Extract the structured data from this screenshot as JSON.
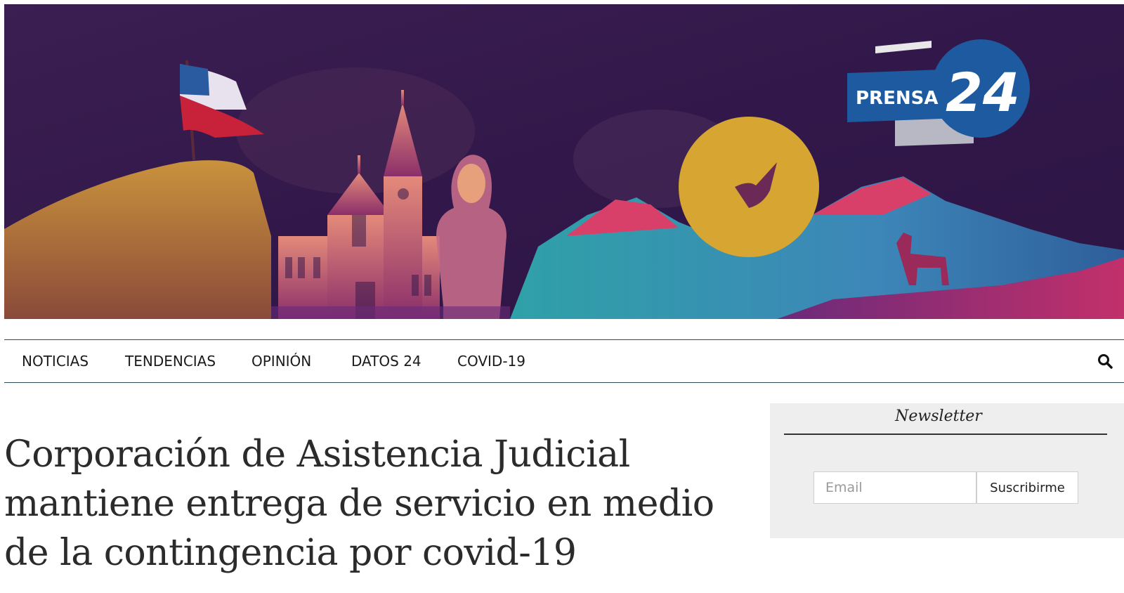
{
  "banner": {
    "logo_text": "PRENSA",
    "logo_number": "24"
  },
  "nav": {
    "items": [
      {
        "label": "NOTICIAS"
      },
      {
        "label": "TENDENCIAS"
      },
      {
        "label": "OPINIÓN"
      },
      {
        "label": "DATOS 24"
      },
      {
        "label": "COVID-19"
      }
    ],
    "search_icon": "search-icon"
  },
  "article": {
    "headline": "Corporación de Asistencia Judicial mantiene entrega de servicio en medio de la contingencia por covid-19"
  },
  "newsletter": {
    "title": "Newsletter",
    "email_placeholder": "Email",
    "email_value": "",
    "submit_label": "Suscribirme"
  },
  "colors": {
    "banner_bg": "#3a1a4c",
    "logo_blue": "#1e5aa0",
    "nav_border": "#2f4b55",
    "panel_bg": "#eeeeee",
    "text": "#2b2b2b"
  }
}
